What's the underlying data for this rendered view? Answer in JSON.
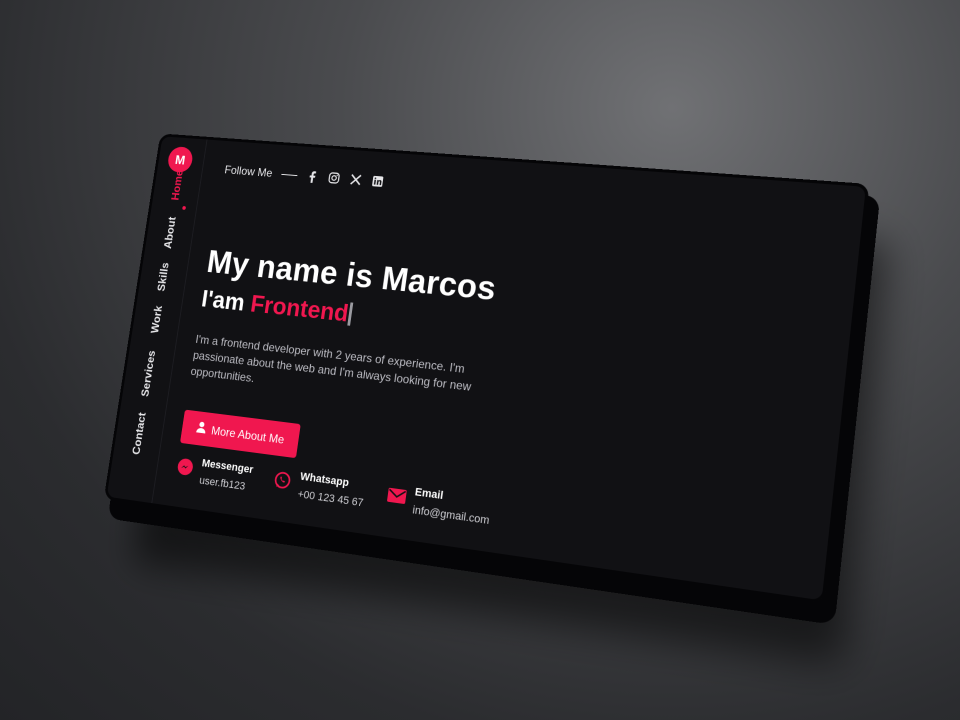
{
  "sidebar": {
    "logo_letter": "M",
    "items": [
      {
        "label": "Home",
        "active": true
      },
      {
        "label": "About",
        "active": false
      },
      {
        "label": "Skills",
        "active": false
      },
      {
        "label": "Work",
        "active": false
      },
      {
        "label": "Services",
        "active": false
      },
      {
        "label": "Contact",
        "active": false
      }
    ]
  },
  "topbar": {
    "follow_label": "Follow Me",
    "social_icons": [
      "facebook-icon",
      "instagram-icon",
      "x-icon",
      "linkedin-icon"
    ]
  },
  "hero": {
    "name_line": "My name is Marcos",
    "role_prefix": "I'am",
    "role": "Frontend",
    "description": "I'm a frontend developer with 2 years of experience. I'm passionate about the web and I'm always looking for new opportunities.",
    "cta_label": "More About Me"
  },
  "contacts": [
    {
      "icon": "messenger-icon",
      "title": "Messenger",
      "value": "user.fb123"
    },
    {
      "icon": "whatsapp-icon",
      "title": "Whatsapp",
      "value": "+00 123 45 67"
    },
    {
      "icon": "email-icon",
      "title": "Email",
      "value": "info@gmail.com"
    }
  ],
  "colors": {
    "accent": "#f0174f",
    "background": "#111114",
    "text": "#ffffff"
  }
}
